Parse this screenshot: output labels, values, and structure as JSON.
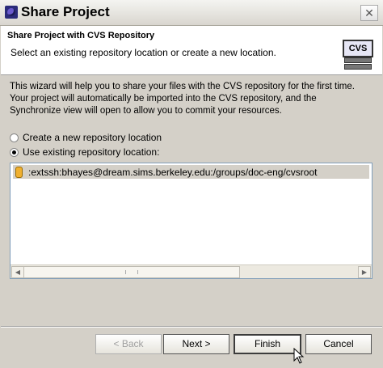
{
  "window": {
    "title": "Share Project",
    "close_glyph": "✕"
  },
  "header": {
    "title": "Share Project with CVS Repository",
    "description": "Select an existing repository location or create a new location.",
    "badge_text": "CVS"
  },
  "intro": {
    "lines": [
      "This wizard will help you to share your files with the CVS repository for the first time.",
      "Your project will automatically be imported into the CVS repository, and the",
      "Synchronize view will open to allow you to commit your resources."
    ]
  },
  "options": {
    "create_new": "Create a new repository location",
    "use_existing": "Use existing repository location:",
    "selected": "use_existing"
  },
  "repositories": [
    ":extssh:bhayes@dream.sims.berkeley.edu:/groups/doc-eng/cvsroot"
  ],
  "buttons": {
    "back": "< Back",
    "next": "Next >",
    "finish": "Finish",
    "cancel": "Cancel"
  }
}
